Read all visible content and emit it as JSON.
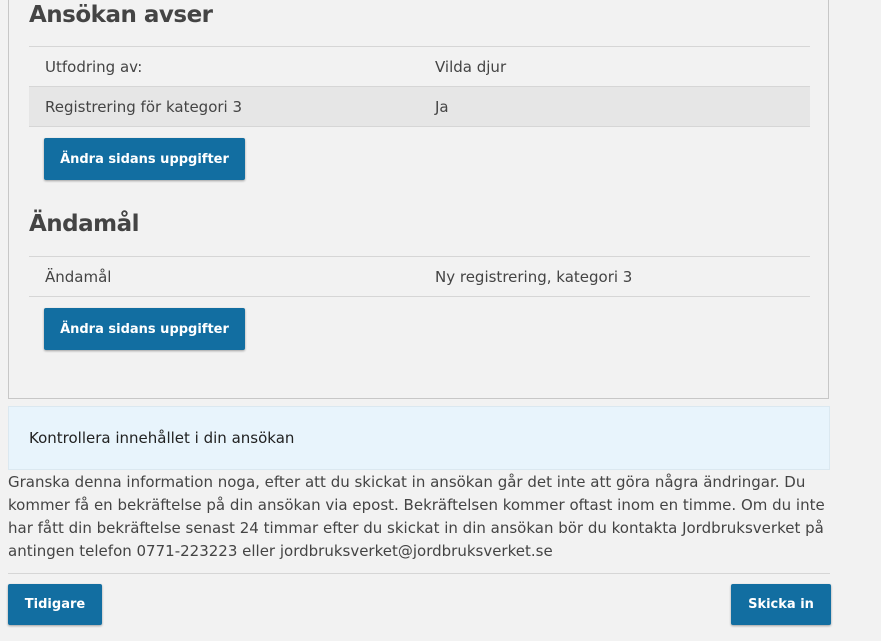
{
  "sections": [
    {
      "title": "Ansökan avser",
      "rows": [
        {
          "label": "Utfodring av:",
          "value": "Vilda djur"
        },
        {
          "label": "Registrering för kategori 3",
          "value": "Ja"
        }
      ],
      "edit_label": "Ändra sidans uppgifter"
    },
    {
      "title": "Ändamål",
      "rows": [
        {
          "label": "Ändamål",
          "value": "Ny registrering, kategori 3"
        }
      ],
      "edit_label": "Ändra sidans uppgifter"
    }
  ],
  "info_box": {
    "text": "Kontrollera innehållet i din ansökan"
  },
  "notice": {
    "text": "Granska denna information noga, efter att du skickat in ansökan går det inte att göra några ändringar. Du kommer få en bekräftelse på din ansökan via epost. Bekräftelsen kommer oftast inom en timme. Om du inte har fått din bekräftelse senast 24 timmar efter du skickat in din ansökan bör du kontakta Jordbruksverket på antingen telefon 0771-223223 eller jordbruksverket@jordbruksverket.se"
  },
  "navigation": {
    "previous_label": "Tidigare",
    "submit_label": "Skicka in"
  },
  "colors": {
    "primary_button": "#126ea1",
    "info_background": "#e8f4fc",
    "page_background": "#f2f2f2",
    "shaded_row": "#e6e6e6"
  }
}
